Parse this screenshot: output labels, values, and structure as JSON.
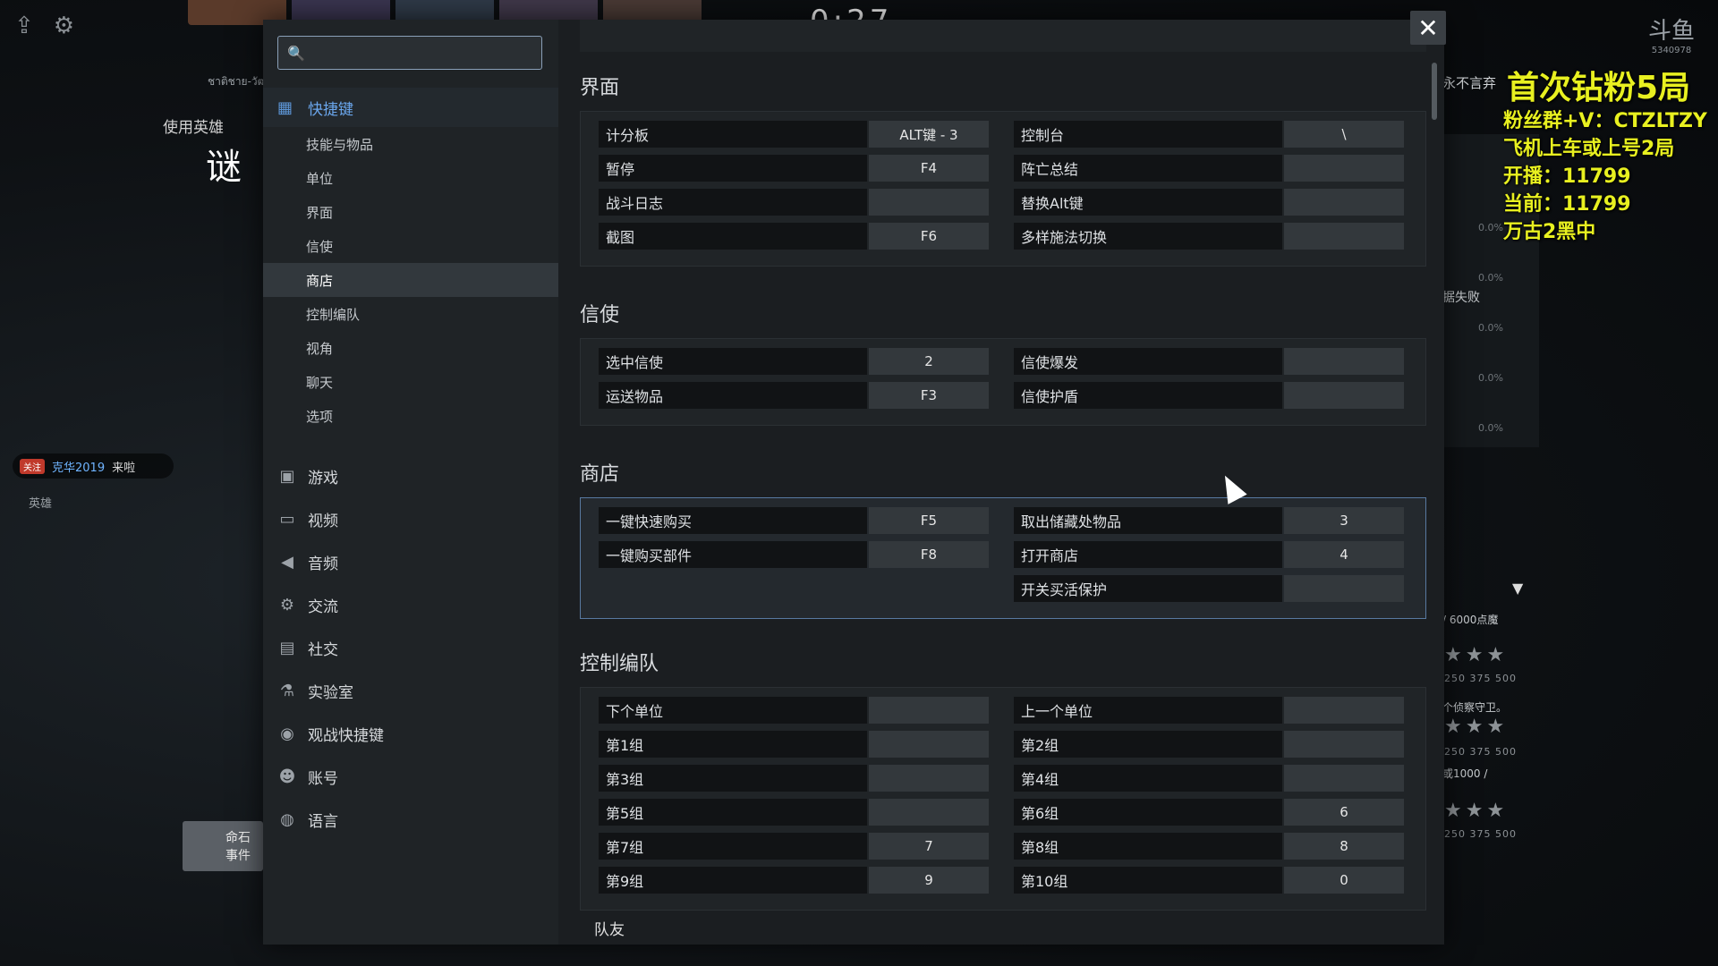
{
  "game": {
    "timer": "0:27",
    "hero_label": "使用英雄",
    "hero_name": "谜",
    "hero_sub": "ชาติชาย-วัฒ",
    "side_label": "英雄",
    "mingshi_line1": "命石",
    "mingshi_line2": "事件",
    "chat": {
      "badge": "关注",
      "user": "克华2019",
      "text": "来啦"
    }
  },
  "search": {
    "placeholder": "",
    "value": ""
  },
  "nav": {
    "hotkeys": "快捷键",
    "sub": [
      "技能与物品",
      "单位",
      "界面",
      "信使",
      "商店",
      "控制编队",
      "视角",
      "聊天",
      "选项"
    ],
    "active_sub": "商店",
    "main": [
      {
        "label": "游戏",
        "icon": "game-icon"
      },
      {
        "label": "视频",
        "icon": "monitor-icon"
      },
      {
        "label": "音频",
        "icon": "speaker-icon"
      },
      {
        "label": "交流",
        "icon": "gear-icon"
      },
      {
        "label": "社交",
        "icon": "chat-icon"
      },
      {
        "label": "实验室",
        "icon": "flask-icon"
      },
      {
        "label": "观战快捷键",
        "icon": "eye-icon"
      },
      {
        "label": "账号",
        "icon": "user-icon"
      },
      {
        "label": "语言",
        "icon": "globe-icon"
      }
    ]
  },
  "sections": {
    "interface": {
      "title": "界面",
      "left": [
        {
          "name": "计分板",
          "key": "ALT键 - 3"
        },
        {
          "name": "暂停",
          "key": "F4"
        },
        {
          "name": "战斗日志",
          "key": ""
        },
        {
          "name": "截图",
          "key": "F6"
        }
      ],
      "right": [
        {
          "name": "控制台",
          "key": "\\"
        },
        {
          "name": "阵亡总结",
          "key": ""
        },
        {
          "name": "替换Alt键",
          "key": ""
        },
        {
          "name": "多样施法切换",
          "key": ""
        }
      ]
    },
    "courier": {
      "title": "信使",
      "left": [
        {
          "name": "选中信使",
          "key": "2"
        },
        {
          "name": "运送物品",
          "key": "F3"
        }
      ],
      "right": [
        {
          "name": "信使爆发",
          "key": ""
        },
        {
          "name": "信使护盾",
          "key": ""
        }
      ]
    },
    "shop": {
      "title": "商店",
      "left": [
        {
          "name": "一键快速购买",
          "key": "F5"
        },
        {
          "name": "一键购买部件",
          "key": "F8"
        }
      ],
      "right": [
        {
          "name": "取出储藏处物品",
          "key": "3"
        },
        {
          "name": "打开商店",
          "key": "4"
        },
        {
          "name": "开关买活保护",
          "key": ""
        }
      ]
    },
    "control_groups": {
      "title": "控制编队",
      "left": [
        {
          "name": "下个单位",
          "key": ""
        },
        {
          "name": "第1组",
          "key": ""
        },
        {
          "name": "第3组",
          "key": ""
        },
        {
          "name": "第5组",
          "key": ""
        },
        {
          "name": "第7组",
          "key": "7"
        },
        {
          "name": "第9组",
          "key": "9"
        }
      ],
      "right": [
        {
          "name": "上一个单位",
          "key": ""
        },
        {
          "name": "第2组",
          "key": ""
        },
        {
          "name": "第4组",
          "key": ""
        },
        {
          "name": "第6组",
          "key": "6"
        },
        {
          "name": "第8组",
          "key": "8"
        },
        {
          "name": "第10组",
          "key": "0"
        }
      ],
      "subhead": "队友"
    }
  },
  "overlay": {
    "line1": "首次钻粉5局",
    "line2": "粉丝群+V：CTZLTZY",
    "line3": "飞机上车或上号2局",
    "line4": "开播：11799",
    "line5": "当前：11799",
    "line6": "万古2黑中",
    "logo": "斗鱼",
    "logo_sub": "5340978"
  },
  "right_panel": {
    "tag": "永不言弃",
    "fail": "据失败",
    "pcts": [
      "0.0%",
      "0.0%",
      "0.0%",
      "0.0%",
      "0.0%"
    ],
    "gold": "/ 6000点魔",
    "ward": "个侦察守卫。",
    "cost": "或1000 /",
    "nums": "250 375 500",
    "stars": "★★★"
  },
  "colors": {
    "accent": "#6aa6ec",
    "overlay": "#e8f020",
    "active_border": "#5879a0"
  }
}
